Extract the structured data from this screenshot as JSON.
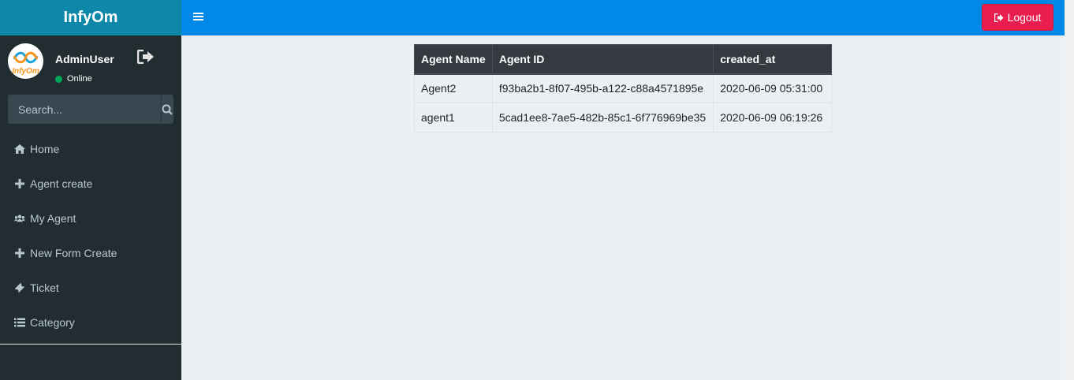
{
  "brand": "InfyOm",
  "user": {
    "name": "AdminUser",
    "status": "Online"
  },
  "avatar_text": "InfyOm",
  "search": {
    "placeholder": "Search..."
  },
  "menu": [
    {
      "label": "Home",
      "icon": "home-icon"
    },
    {
      "label": "Agent create",
      "icon": "plus-icon"
    },
    {
      "label": "My Agent",
      "icon": "users-icon"
    },
    {
      "label": "New Form Create",
      "icon": "plus-icon"
    },
    {
      "label": "Ticket",
      "icon": "ticket-icon"
    },
    {
      "label": "Category",
      "icon": "list-icon"
    }
  ],
  "header": {
    "logout_label": "Logout"
  },
  "table": {
    "columns": [
      "Agent Name",
      "Agent ID",
      "created_at"
    ],
    "rows": [
      [
        "Agent2",
        "f93ba2b1-8f07-495b-a122-c88a4571895e",
        "2020-06-09 05:31:00"
      ],
      [
        "agent1",
        "5cad1ee8-7ae5-482b-85c1-6f776969be35",
        "2020-06-09 06:19:26"
      ]
    ]
  },
  "colors": {
    "sidebar": "#222d32",
    "brand_bg": "#0d88a8",
    "header": "#0288e6",
    "logout": "#e91e4f",
    "online": "#00a65a"
  }
}
